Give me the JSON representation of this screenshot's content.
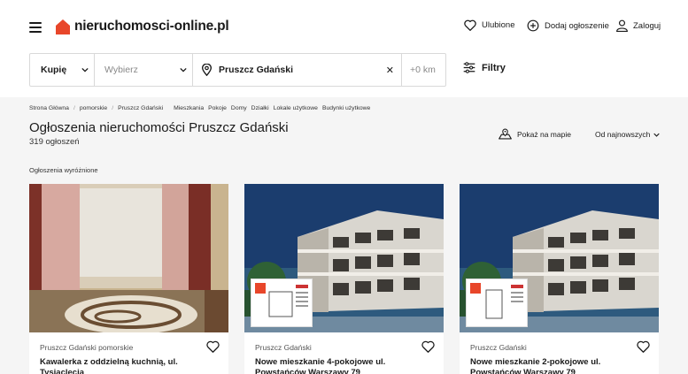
{
  "header": {
    "logo_text": "nieruchomosci-online.pl",
    "favorites_label": "Ulubione",
    "add_listing_label": "Dodaj ogłoszenie",
    "login_label": "Zaloguj"
  },
  "search": {
    "transaction": "Kupię",
    "property_type_placeholder": "Wybierz",
    "location": "Pruszcz Gdański",
    "radius": "+0 km",
    "filters_label": "Filtry"
  },
  "breadcrumbs": [
    "Strona Główna",
    "pomorskie",
    "Pruszcz Gdański"
  ],
  "categories": [
    "Mieszkania",
    "Pokoje",
    "Domy",
    "Działki",
    "Lokale użytkowe",
    "Budynki użytkowe"
  ],
  "page": {
    "title": "Ogłoszenia nieruchomości Pruszcz Gdański",
    "count": "319 ogłoszeń",
    "map_label": "Pokaż na mapie",
    "sort_label": "Od najnowszych",
    "featured_label": "Ogłoszenia wyróżnione"
  },
  "listings": [
    {
      "location": "Pruszcz Gdański pomorskie",
      "title": "Kawalerka z oddzielną kuchnią, ul. Tysiąclecia"
    },
    {
      "location": "Pruszcz Gdański",
      "title": "Nowe mieszkanie 4-pokojowe ul. Powstańców Warszawy 79"
    },
    {
      "location": "Pruszcz Gdański",
      "title": "Nowe mieszkanie 2-pokojowe ul. Powstańców Warszawy 79"
    }
  ],
  "colors": {
    "brand": "#e8462a",
    "background_gray": "#f5f5f5"
  }
}
